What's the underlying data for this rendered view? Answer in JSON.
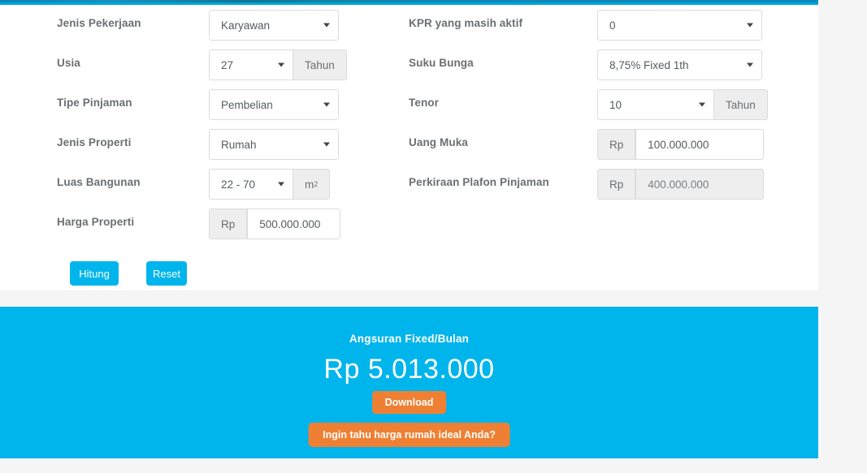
{
  "theme": {
    "accent_blue": "#00b4ec",
    "top_bar_blue": "#00a6d6",
    "orange": "#ef8033",
    "label_gray": "#6b6f72",
    "panel_bg": "#ffffff",
    "page_bg": "#f5f5f5"
  },
  "form": {
    "left_column": [
      {
        "label": "Jenis Pekerjaan",
        "type": "select",
        "value": "Karyawan",
        "addon": null
      },
      {
        "label": "Usia",
        "type": "select-addon",
        "value": "27",
        "addon": "Tahun"
      },
      {
        "label": "Tipe Pinjaman",
        "type": "select",
        "value": "Pembelian",
        "addon": null
      },
      {
        "label": "Jenis Properti",
        "type": "select",
        "value": "Rumah",
        "addon": null
      },
      {
        "label": "Luas Bangunan",
        "type": "select-addon",
        "value": "22 - 70",
        "addon": "m2"
      },
      {
        "label": "Harga Properti",
        "type": "currency",
        "value": "500.000.000",
        "addon": "Rp"
      }
    ],
    "right_column": [
      {
        "label": "KPR yang masih aktif",
        "type": "select",
        "value": "0",
        "addon": null
      },
      {
        "label": "Suku Bunga",
        "type": "select",
        "value": "8,75% Fixed 1th",
        "addon": null
      },
      {
        "label": "Tenor",
        "type": "select-addon",
        "value": "10",
        "addon": "Tahun"
      },
      {
        "label": "Uang Muka",
        "type": "currency",
        "value": "100.000.000",
        "addon": "Rp"
      },
      {
        "label": "Perkiraan Plafon Pinjaman",
        "type": "currency-disabled",
        "value": "400.000.000",
        "addon": "Rp"
      }
    ],
    "buttons": {
      "calculate": "Hitung",
      "reset": "Reset"
    }
  },
  "result": {
    "title": "Angsuran Fixed/Bulan",
    "amount": "Rp 5.013.000",
    "download_button": "Download",
    "ideal_price_button": "Ingin tahu harga rumah ideal Anda?"
  }
}
